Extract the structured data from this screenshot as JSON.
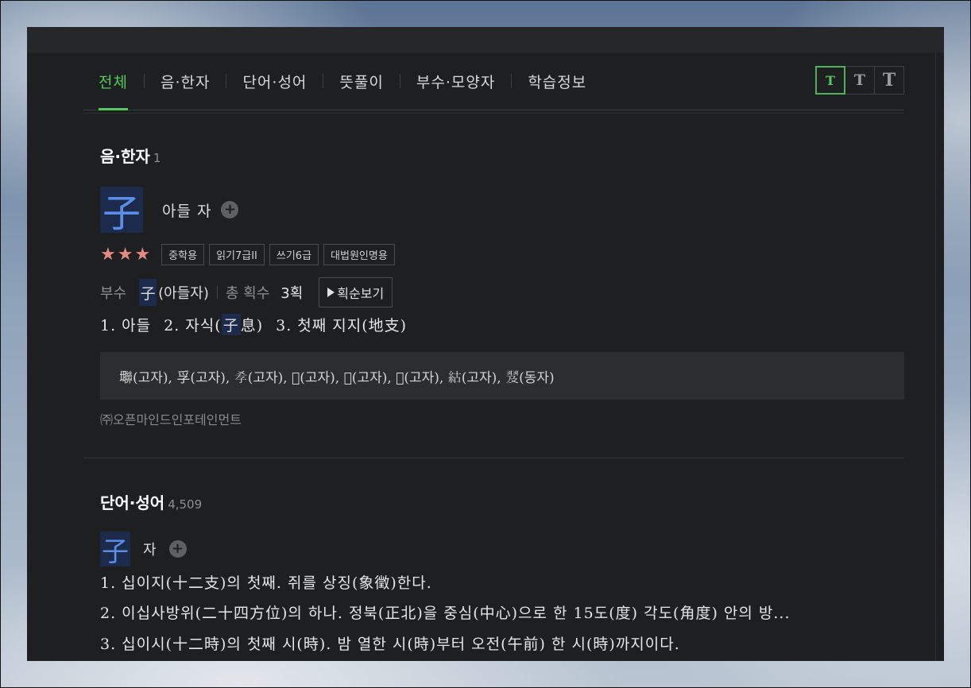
{
  "tabs": [
    "전체",
    "음·한자",
    "단어·성어",
    "뜻풀이",
    "부수·모양자",
    "학습정보"
  ],
  "font_size_buttons": [
    "T",
    "T",
    "T"
  ],
  "hanja_section": {
    "title": "음·한자",
    "count": "1",
    "character": "子",
    "reading": "아들 자",
    "plus": "+",
    "stars": "★★★",
    "tags": [
      "중학용",
      "읽기7급II",
      "쓰기6급",
      "대법원인명용"
    ],
    "radical_label": "부수",
    "radical_char": "子",
    "radical_name": "(아들자)",
    "stroke_label": "총 획수",
    "stroke_count": "3획",
    "stroke_button": "획순보기",
    "meanings": {
      "m1": "1. 아들",
      "m2_pre": "2. 자식(",
      "m2_hl": "子",
      "m2_post": "息)",
      "m3": "3. 첫째 지지(地支)"
    },
    "related_chars": "壣(고자), 孚(고자), 𡥉(고자), 𢍉(고자), 𢍉(고자), 𤔺(고자), 𥿍(고자), 𦐅(동자)",
    "source": "㈜오픈마인드인포테인먼트"
  },
  "word_section": {
    "title": "단어·성어",
    "count": "4,509",
    "character": "子",
    "reading": "자",
    "plus": "+",
    "definitions": [
      "1. 십이지(十二支)의 첫째. 쥐를 상징(象徵)한다.",
      "2. 이십사방위(二十四方位)의 하나. 정북(正北)을 중심(中心)으로 한 15도(度) 각도(角度) 안의 방...",
      "3. 십이시(十二時)의 첫째 시(時). 밤 열한 시(時)부터 오전(午前) 한 시(時)까지이다."
    ]
  }
}
